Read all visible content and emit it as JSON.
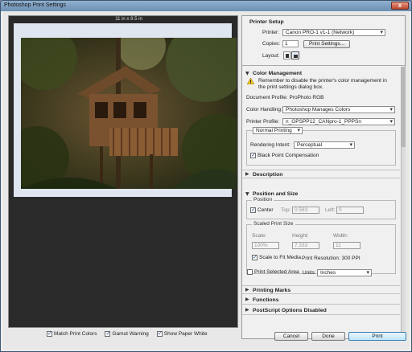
{
  "window": {
    "title": "Photoshop Print Settings",
    "close": "x"
  },
  "preview": {
    "paper_size": "11 in x 8.5 in",
    "options": [
      {
        "label": "Match Print Colors",
        "checked": true
      },
      {
        "label": "Gamut Warning",
        "checked": true
      },
      {
        "label": "Show Paper White",
        "checked": true
      }
    ]
  },
  "printer_setup": {
    "header": "Printer Setup",
    "printer_label": "Printer:",
    "printer_value": "Canon PRO-1 v1-1 (Network)",
    "copies_label": "Copies:",
    "copies_value": "1",
    "print_settings_button": "Print Settings...",
    "layout_label": "Layout:"
  },
  "color_management": {
    "header": "Color Management",
    "note": "Remember to disable the printer's color management in the print settings dialog box.",
    "doc_profile": "Document Profile: ProPhoto RGB",
    "color_handling_label": "Color Handling:",
    "color_handling_value": "Photoshop Manages Colors",
    "printer_profile_label": "Printer Profile:",
    "printer_profile_value": "n_GPSPP12_CANpro-1_PPPSn",
    "mode_value": "Normal Printing",
    "rendering_intent_label": "Rendering Intent:",
    "rendering_intent_value": "Perceptual",
    "bpc_label": "Black Point Compensation"
  },
  "description": {
    "header": "Description"
  },
  "position_size": {
    "header": "Position and Size",
    "position_title": "Position",
    "center_label": "Center",
    "top_label": "Top:",
    "top_value": "0.583",
    "left_label": "Left:",
    "left_value": "0",
    "scaled_title": "Scaled Print Size",
    "scale_label": "Scale:",
    "scale_value": "100%",
    "height_label": "Height:",
    "height_value": "7.333",
    "width_label": "Width:",
    "width_value": "11",
    "scale_fit_label": "Scale to Fit Media",
    "resolution": "Print Resolution: 300 PPI",
    "print_selected_label": "Print Selected Area",
    "units_label": "Units:",
    "units_value": "Inches"
  },
  "sections": {
    "printing_marks": "Printing Marks",
    "functions": "Functions",
    "postscript": "PostScript Options Disabled"
  },
  "footer": {
    "cancel": "Cancel",
    "done": "Done",
    "print": "Print"
  }
}
